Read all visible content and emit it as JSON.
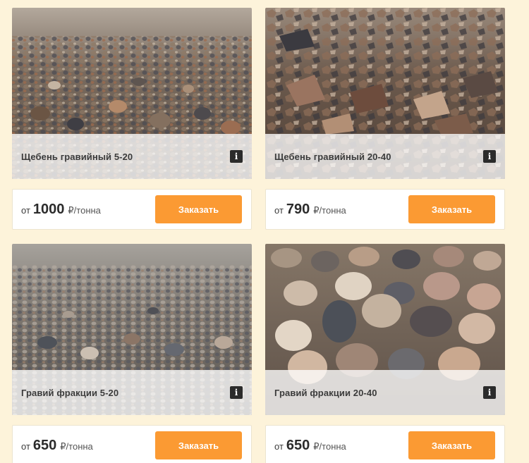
{
  "products": [
    {
      "title": "Щебень гравийный 5-20",
      "info_icon": "i",
      "icon_name": "info-icon",
      "price_prefix": "от",
      "price": "1000",
      "unit": "₽/тонна",
      "button_label": "Заказать"
    },
    {
      "title": "Щебень гравийный 20-40",
      "info_icon": "i",
      "icon_name": "info-icon",
      "price_prefix": "от",
      "price": "790",
      "unit": "₽/тонна",
      "button_label": "Заказать"
    },
    {
      "title": "Гравий фракции 5-20",
      "info_icon": "i",
      "icon_name": "info-icon",
      "price_prefix": "от",
      "price": "650",
      "unit": "₽/тонна",
      "button_label": "Заказать"
    },
    {
      "title": "Гравий фракции 20-40",
      "info_icon": "i",
      "icon_name": "info-icon",
      "price_prefix": "от",
      "price": "650",
      "unit": "₽/тонна",
      "button_label": "Заказать"
    }
  ],
  "colors": {
    "page_background": "#fdf3da",
    "button": "#fb9a33",
    "button_text": "#ffffff",
    "info_icon_bg": "#2b2b2b"
  }
}
